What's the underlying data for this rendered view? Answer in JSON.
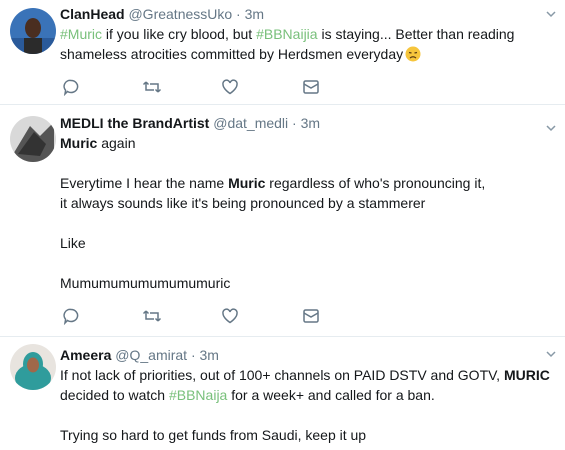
{
  "tweets": [
    {
      "name": "ClanHead",
      "handle": "@GreatnessUko",
      "sep": " · ",
      "time": "3m",
      "lines": [
        {
          "t_pre": "",
          "tag1": "#Muric",
          "mid": " if you like cry blood, but ",
          "tag2": "#BBNaijia",
          "post": " is staying... Better than reading"
        },
        {
          "text": "shameless atrocities committed by Herdsmen everyday"
        }
      ],
      "emoji": "disappointed-face-icon"
    },
    {
      "name": "MEDLI the BrandArtist",
      "handle": "@dat_medli",
      "sep": " · ",
      "time": "3m",
      "line1_bold": "Muric",
      "line1_rest": " again",
      "line3_pre": "Everytime I hear the name ",
      "line3_bold": "Muric",
      "line3_post": " regardless of who's pronouncing it,",
      "line4": "it always sounds like it's being pronounced by a stammerer",
      "line6": "Like",
      "line8": "Mumumumumumumumuric"
    },
    {
      "name": "Ameera",
      "handle": "@Q_amirat",
      "sep": " · ",
      "time": "3m",
      "line1": "If not lack of priorities, out of 100+ channels on PAID DSTV and GOTV, ",
      "line1_bold": "MURIC",
      "line2_pre": "decided to watch ",
      "line2_tag": "#BBNaija",
      "line2_post": " for a week+ and called for a ban.",
      "line4": "Trying so hard to get funds from Saudi, keep it up"
    }
  ],
  "actions": [
    "reply-icon",
    "retweet-icon",
    "like-icon",
    "message-icon"
  ],
  "colors": {
    "hashtag": "#79c07b",
    "muted": "#657786",
    "text": "#14171a",
    "divider": "#e6ecf0"
  }
}
